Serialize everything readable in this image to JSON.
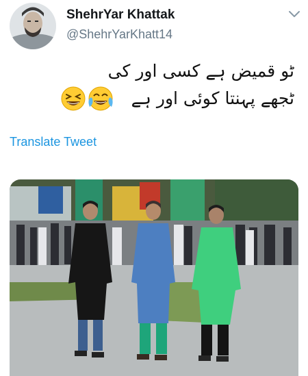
{
  "author": {
    "display_name": "ShehrYar Khattak",
    "handle": "@ShehrYarKhatt14",
    "avatar_icon": "avatar-photo"
  },
  "tweet": {
    "lines": [
      "ٹو قمیض ہے کسی اور کی",
      "ٹجھے پہنتا کوئی اور ہے"
    ],
    "emojis": [
      "grinning-squinting-face",
      "face-with-tears-of-joy"
    ],
    "translate_label": "Translate Tweet"
  },
  "media": {
    "description_icon": "photo-three-men-walking"
  },
  "colors": {
    "link": "#1b95e0",
    "handle": "#657786",
    "name": "#14171a"
  }
}
